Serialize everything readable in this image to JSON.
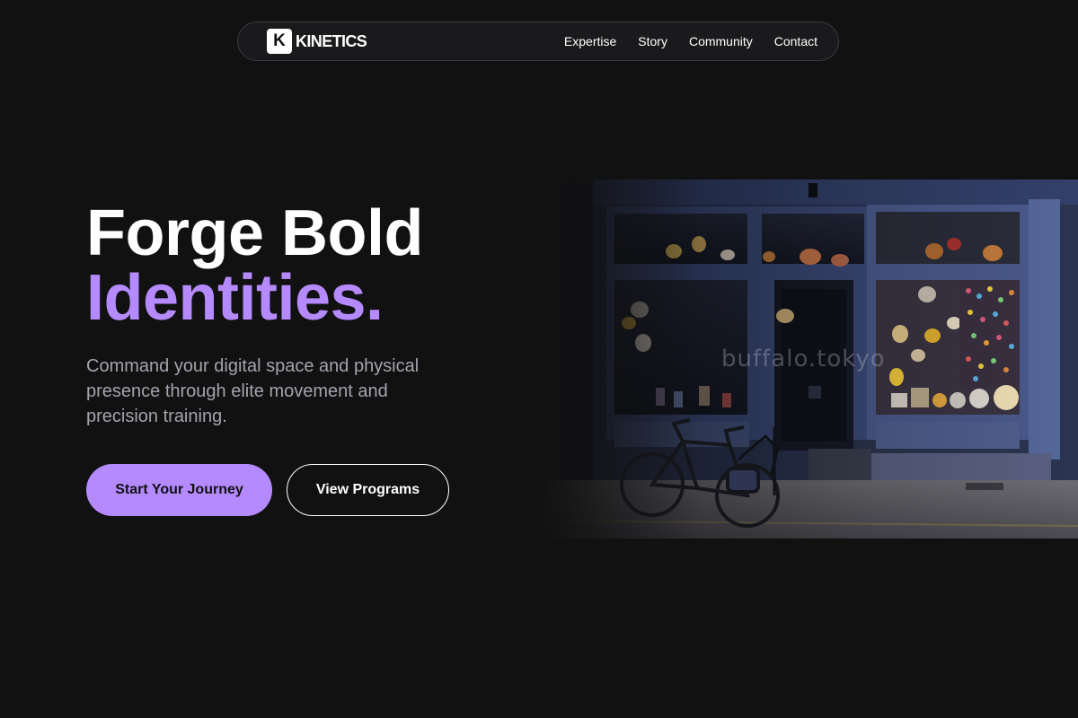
{
  "nav": {
    "brand_mark": "K",
    "brand_name": "KINETICS",
    "links": [
      {
        "label": "Expertise"
      },
      {
        "label": "Story"
      },
      {
        "label": "Community"
      },
      {
        "label": "Contact"
      }
    ]
  },
  "hero": {
    "title_line1": "Forge Bold",
    "title_line2": "Identities.",
    "subtitle": "Command your digital space and physical presence through elite movement and precision training.",
    "primary_cta": "Start Your Journey",
    "secondary_cta": "View Programs"
  },
  "image": {
    "watermark": "buffalo.tokyo"
  },
  "colors": {
    "background": "#111111",
    "accent": "#b58aff",
    "subtitle": "#a3a3ad",
    "nav_border": "#3a3a44"
  }
}
